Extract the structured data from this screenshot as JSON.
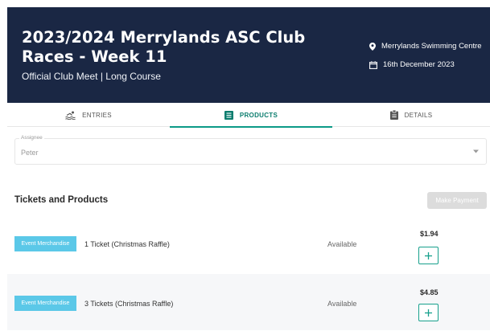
{
  "event": {
    "title": "2023/2024 Merrylands ASC Club Races - Week 11",
    "subtitle": "Official Club Meet | Long Course",
    "location": "Merrylands Swimming Centre",
    "date": "16th December 2023"
  },
  "tabs": [
    {
      "label": "ENTRIES",
      "icon": "swimmer-icon",
      "active": false
    },
    {
      "label": "PRODUCTS",
      "icon": "list-icon",
      "active": true
    },
    {
      "label": "DETAILS",
      "icon": "clipboard-icon",
      "active": false
    }
  ],
  "assignee": {
    "label": "Assignee",
    "value": "Peter"
  },
  "products_section": {
    "title": "Tickets and Products",
    "make_payment_label": "Make Payment"
  },
  "products": [
    {
      "category": "Event Merchandise",
      "name": "1 Ticket (Christmas Raffle)",
      "status": "Available",
      "price": "$1.94"
    },
    {
      "category": "Event Merchandise",
      "name": "3 Tickets (Christmas Raffle)",
      "status": "Available",
      "price": "$4.85"
    }
  ],
  "colors": {
    "header_bg": "#1a2744",
    "accent": "#0b9a87",
    "badge_bg": "#5bc8e8"
  }
}
